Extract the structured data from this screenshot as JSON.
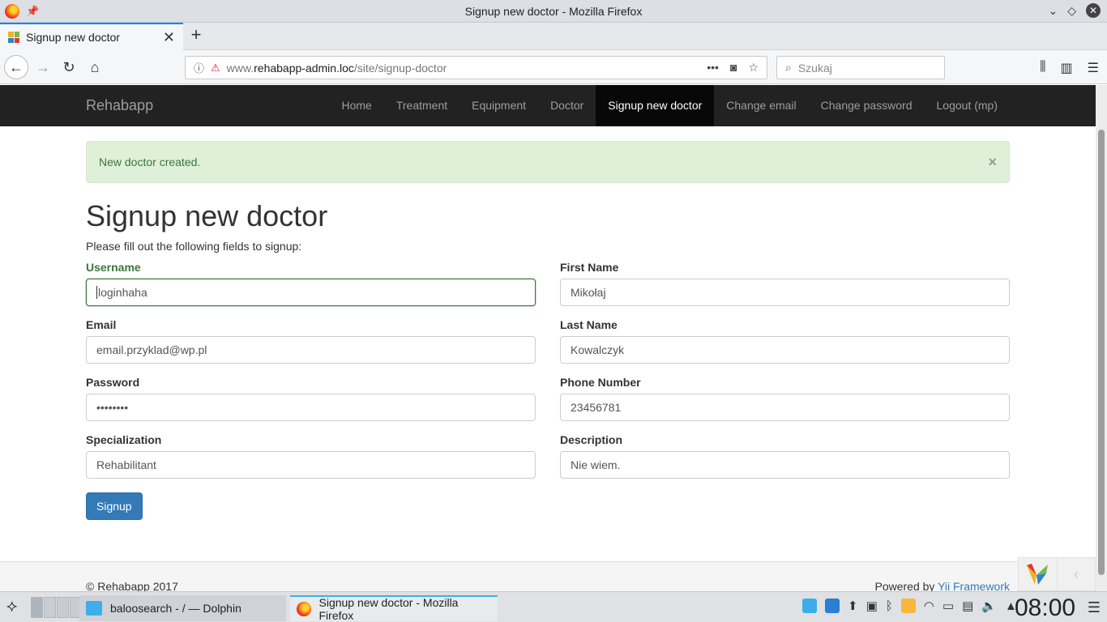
{
  "window": {
    "title": "Signup new doctor - Mozilla Firefox"
  },
  "browser": {
    "tab_label": "Signup new doctor",
    "url_prefix": "www.",
    "url_domain": "rehabapp-admin.loc",
    "url_path": "/site/signup-doctor",
    "search_placeholder": "Szukaj"
  },
  "site": {
    "brand": "Rehabapp",
    "menu": [
      "Home",
      "Treatment",
      "Equipment",
      "Doctor",
      "Signup new doctor",
      "Change email",
      "Change password",
      "Logout (mp)"
    ],
    "active_menu": "Signup new doctor"
  },
  "alert": {
    "message": "New doctor created.",
    "close": "×"
  },
  "form": {
    "title": "Signup new doctor",
    "intro": "Please fill out the following fields to signup:",
    "username": {
      "label": "Username",
      "value": "loginhaha"
    },
    "first_name": {
      "label": "First Name",
      "value": "Mikołaj"
    },
    "email": {
      "label": "Email",
      "value": "email.przyklad@wp.pl"
    },
    "last_name": {
      "label": "Last Name",
      "value": "Kowalczyk"
    },
    "password": {
      "label": "Password",
      "value": "••••••••"
    },
    "phone": {
      "label": "Phone Number",
      "value": "23456781"
    },
    "specialization": {
      "label": "Specialization",
      "value": "Rehabilitant"
    },
    "description": {
      "label": "Description",
      "value": "Nie wiem."
    },
    "submit": "Signup"
  },
  "footer": {
    "copyright": "© Rehabapp 2017",
    "powered_prefix": "Powered by ",
    "powered_link": "Yii Framework"
  },
  "taskbar": {
    "task1": "baloosearch - / — Dolphin",
    "task2": "Signup new doctor - Mozilla Firefox",
    "clock": "08:00"
  },
  "colors": {
    "navbar_bg": "#222222",
    "alert_bg": "#dff0d8",
    "alert_text": "#3c763d",
    "button_primary": "#337ab7",
    "success_border": "#3c763d"
  }
}
